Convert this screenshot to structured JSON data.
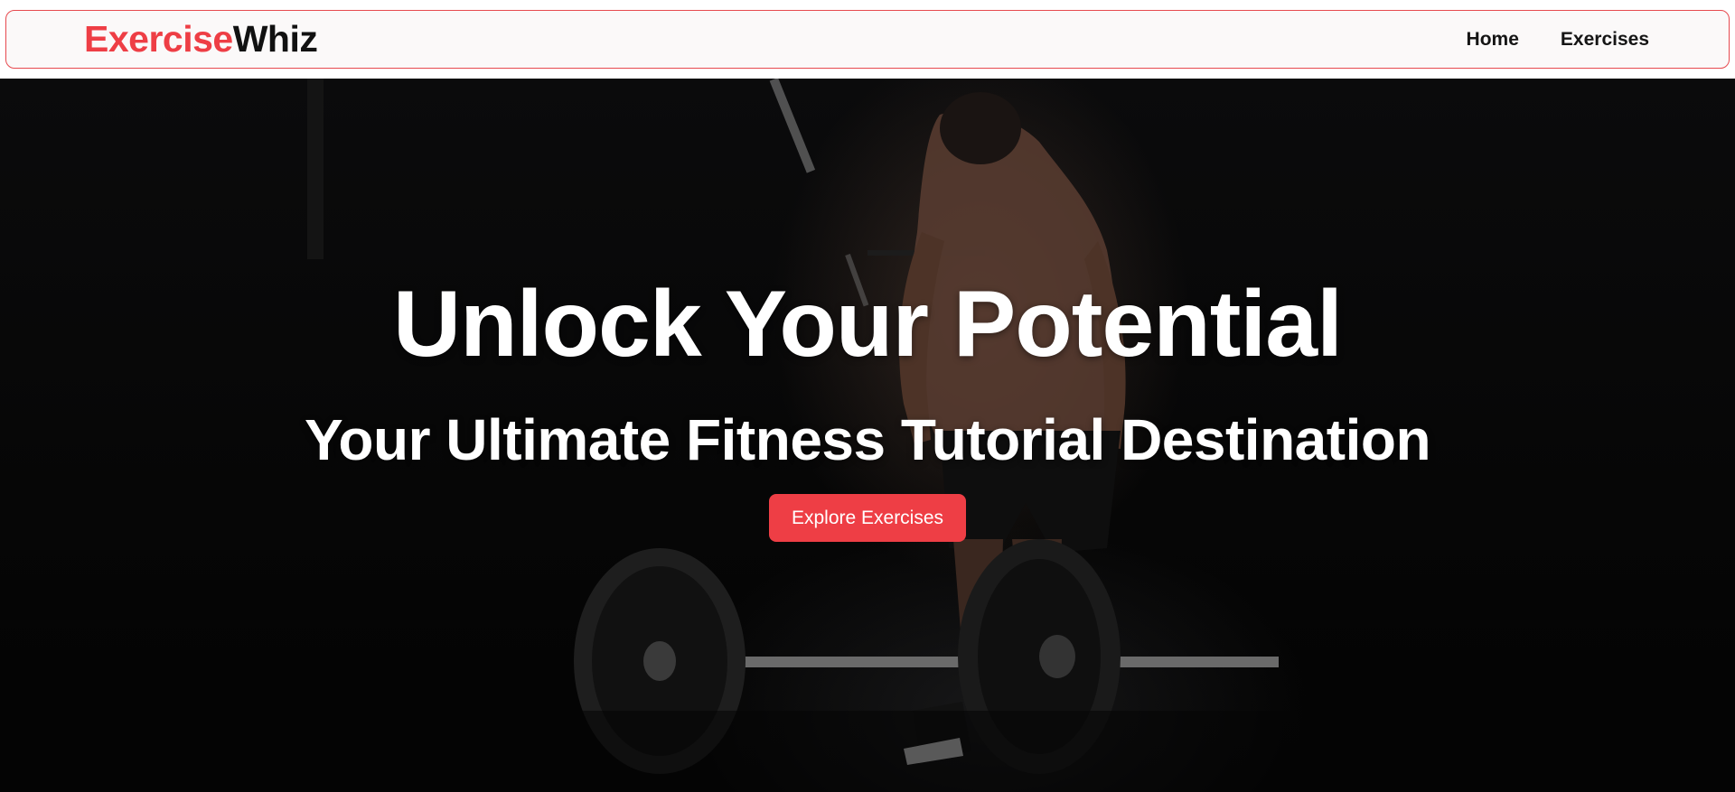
{
  "navbar": {
    "brand_part1": "Exercise",
    "brand_part2": "Whiz",
    "links": [
      {
        "label": "Home"
      },
      {
        "label": "Exercises"
      }
    ]
  },
  "hero": {
    "title": "Unlock Your Potential",
    "subtitle": "Your Ultimate Fitness Tutorial Destination",
    "cta_label": "Explore Exercises"
  },
  "colors": {
    "accent": "#ee3e45",
    "nav_border": "#e74a4f",
    "nav_background": "#fbf9f9",
    "hero_background": "#000000"
  }
}
